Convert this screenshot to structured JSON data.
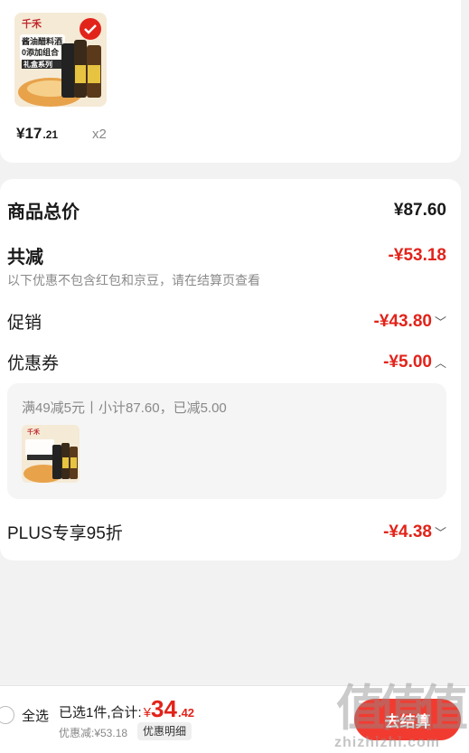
{
  "product": {
    "thumb_brand": "千禾",
    "thumb_title": "酱油醋料酒0添加组合",
    "thumb_badge": "礼盒系列",
    "price_main": "¥17",
    "price_dec": ".21",
    "qty": "x2"
  },
  "summary": {
    "total_label": "商品总价",
    "total_value": "¥87.60",
    "reduce_label": "共减",
    "reduce_value": "-¥53.18",
    "note": "以下优惠不包含红包和京豆，请在结算页查看",
    "promo_label": "促销",
    "promo_value": "-¥43.80",
    "coupon_label": "优惠券",
    "coupon_value": "-¥5.00",
    "coupon_detail": "满49减5元丨小计87.60，已减5.00",
    "plus_label": "PLUS专享95折",
    "plus_value": "-¥4.38"
  },
  "bottom": {
    "select_all": "全选",
    "selected_text": "已选1件,合计:",
    "currency": "¥",
    "total_big": "34",
    "total_dec": ".42",
    "discount_text": "优惠减:¥53.18",
    "detail_button": "优惠明细",
    "checkout_button": "去结算",
    "watermark_text": "值",
    "watermark_url": "zhizhizhi.com"
  },
  "colors": {
    "accent": "#e2231a",
    "checkout": "#f23b30"
  }
}
